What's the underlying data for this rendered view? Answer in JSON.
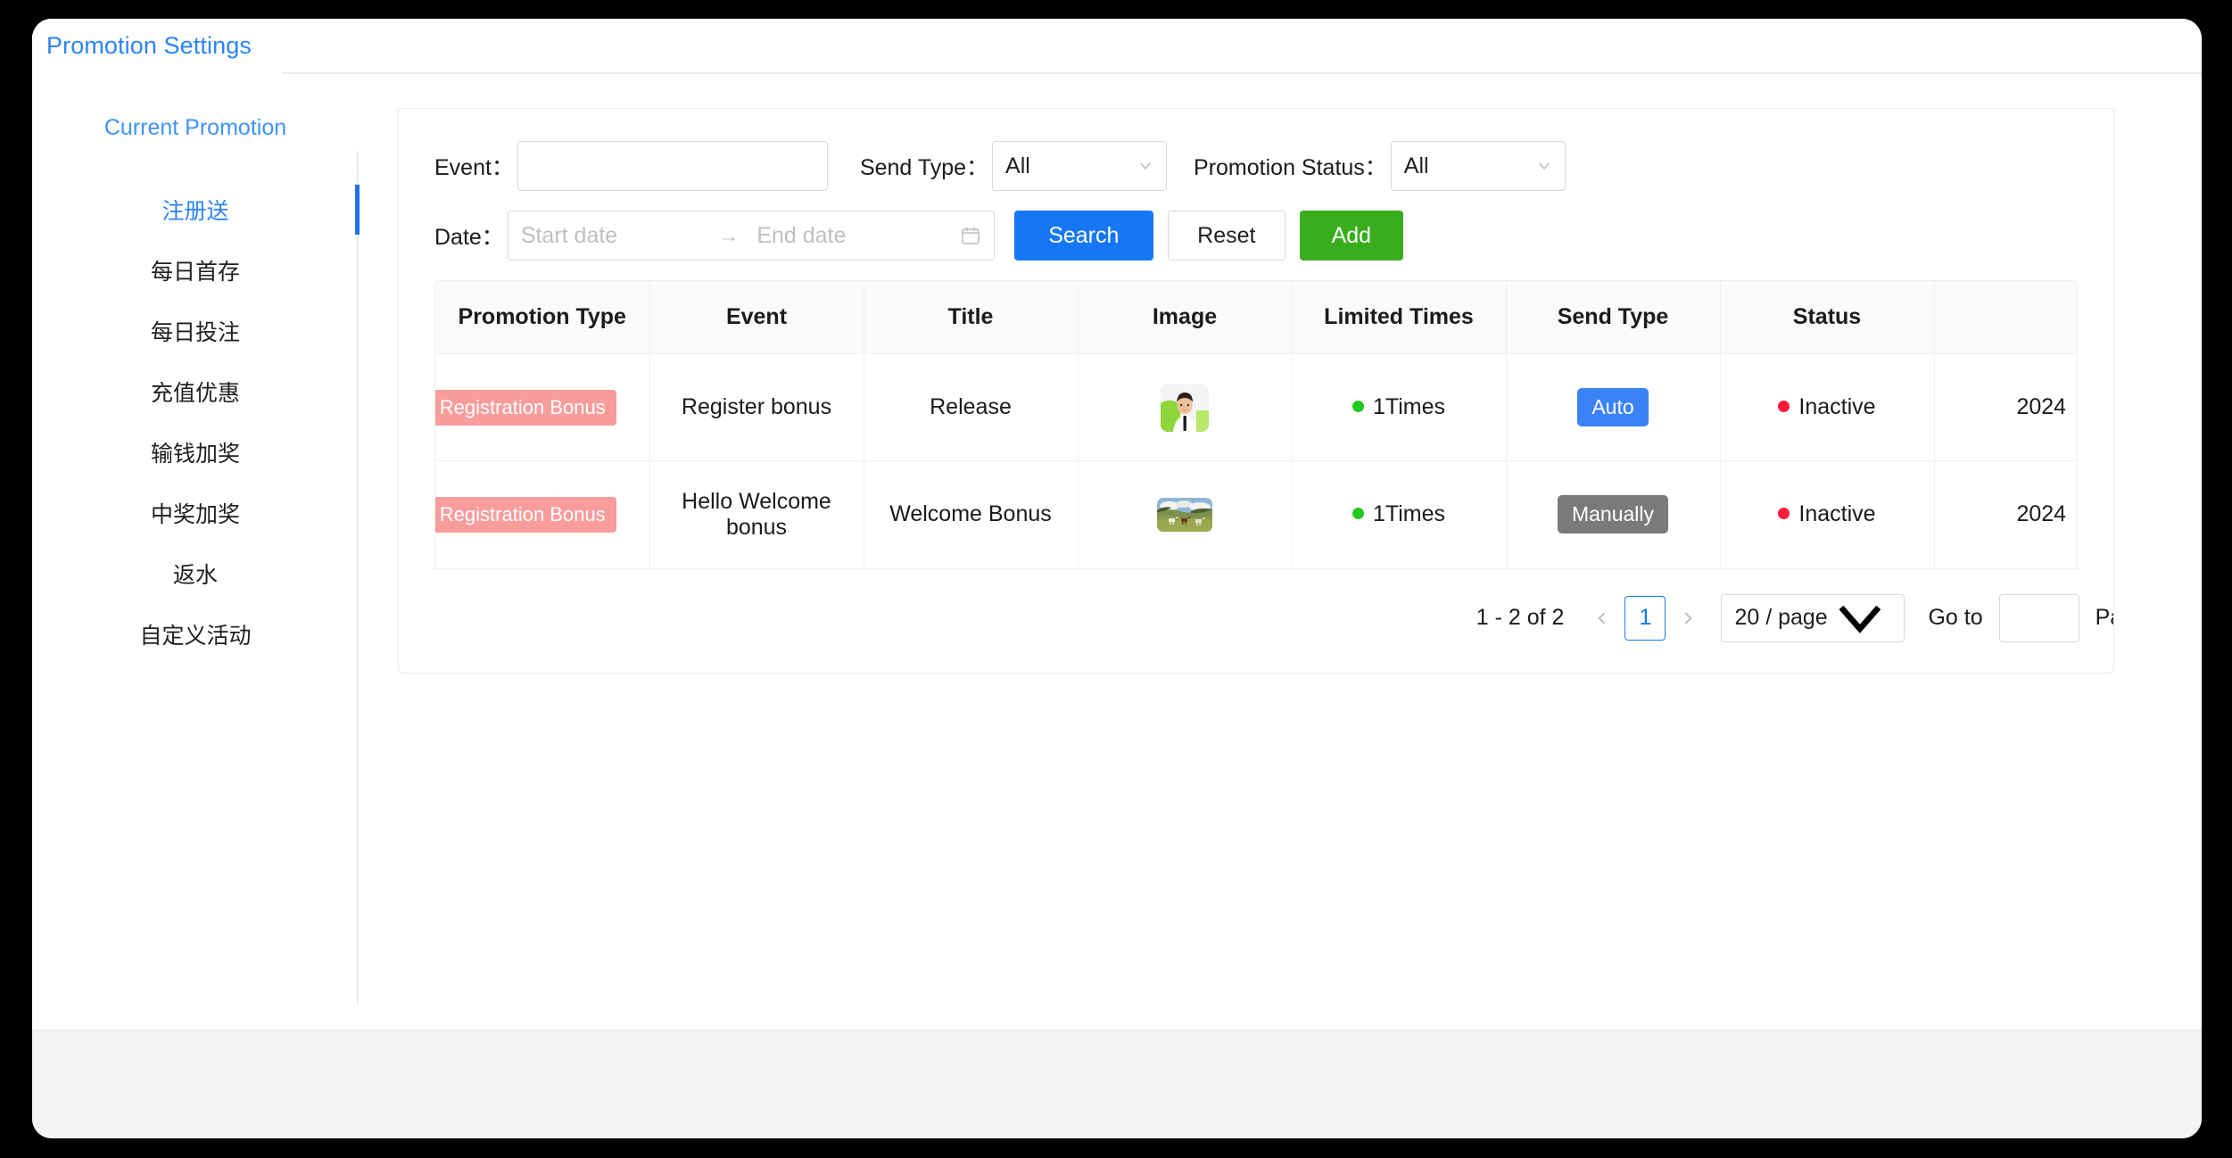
{
  "window": {
    "header": {
      "tab_label": "Promotion Settings"
    }
  },
  "sidebar": {
    "heading": "Current Promotion",
    "items": [
      {
        "label": "注册送",
        "active": true
      },
      {
        "label": "每日首存",
        "active": false
      },
      {
        "label": "每日投注",
        "active": false
      },
      {
        "label": "充值优惠",
        "active": false
      },
      {
        "label": "输钱加奖",
        "active": false
      },
      {
        "label": "中奖加奖",
        "active": false
      },
      {
        "label": "返水",
        "active": false
      },
      {
        "label": "自定义活动",
        "active": false
      }
    ]
  },
  "filters": {
    "event": {
      "label": "Event：",
      "value": "",
      "placeholder": ""
    },
    "send_type": {
      "label": "Send Type：",
      "value": "All"
    },
    "promotion_status": {
      "label": "Promotion Status：",
      "value": "All"
    },
    "date": {
      "label": "Date：",
      "start_placeholder": "Start date",
      "end_placeholder": "End date",
      "separator": "→",
      "calendar_icon": "calendar-icon"
    },
    "buttons": {
      "search": "Search",
      "reset": "Reset",
      "add": "Add"
    }
  },
  "table": {
    "columns": [
      "Promotion Type",
      "Event",
      "Title",
      "Image",
      "Limited Times",
      "Send Type",
      "Status",
      ""
    ],
    "rows": [
      {
        "promotion_type": "Registration Bonus",
        "event": "Register bonus",
        "title": "Release",
        "image": "portrait-man-thumbnail",
        "limited_times": "1Times",
        "send_type": "Auto",
        "send_type_style": "auto",
        "status": "Inactive",
        "date": "2024"
      },
      {
        "promotion_type": "Registration Bonus",
        "event": "Hello Welcome bonus",
        "title": "Welcome Bonus",
        "image": "horses-field-thumbnail",
        "limited_times": "1Times",
        "send_type": "Manually",
        "send_type_style": "manual",
        "status": "Inactive",
        "date": "2024"
      }
    ]
  },
  "pagination": {
    "total_text": "1 - 2 of 2",
    "prev_icon": "chevron-left-icon",
    "next_icon": "chevron-right-icon",
    "current_page": "1",
    "page_size": "20 / page",
    "goto_label": "Go to",
    "goto_value": "",
    "page_label": "Page"
  },
  "colors": {
    "accent_blue": "#1677f6",
    "link_blue": "#2b85f5",
    "success_green": "#39ad1c",
    "tag_salmon": "#f89c9c",
    "badge_gray": "#7a7a7a",
    "status_red": "#fb1c3a",
    "status_green": "#21c91f"
  }
}
